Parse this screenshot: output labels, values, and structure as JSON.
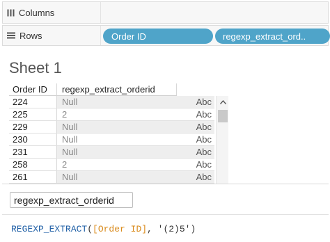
{
  "colors": {
    "pill": "#4fa4c9",
    "func": "#1f5fa6",
    "field": "#d98a1a",
    "string": "#333333",
    "punct": "#333333"
  },
  "shelves": {
    "columns": {
      "icon": "columns-icon",
      "label": "Columns"
    },
    "rows": {
      "icon": "rows-icon",
      "label": "Rows",
      "pills": [
        "Order ID",
        "regexp_extract_ord.."
      ]
    }
  },
  "sheet": {
    "title": "Sheet 1",
    "headers": {
      "order_id": "Order ID",
      "calc": "regexp_extract_orderid"
    },
    "rows": [
      {
        "order_id": "224",
        "value": "Null",
        "type": "Abc"
      },
      {
        "order_id": "225",
        "value": "2",
        "type": "Abc"
      },
      {
        "order_id": "229",
        "value": "Null",
        "type": "Abc"
      },
      {
        "order_id": "230",
        "value": "Null",
        "type": "Abc"
      },
      {
        "order_id": "231",
        "value": "Null",
        "type": "Abc"
      },
      {
        "order_id": "258",
        "value": "2",
        "type": "Abc"
      },
      {
        "order_id": "261",
        "value": "Null",
        "type": "Abc"
      }
    ]
  },
  "calc_editor": {
    "name": "regexp_extract_orderid",
    "formula": {
      "func": "REGEXP_EXTRACT",
      "open": "(",
      "field": "[Order ID]",
      "sep": ", ",
      "pattern": "'(2)5'",
      "close": ")"
    }
  }
}
